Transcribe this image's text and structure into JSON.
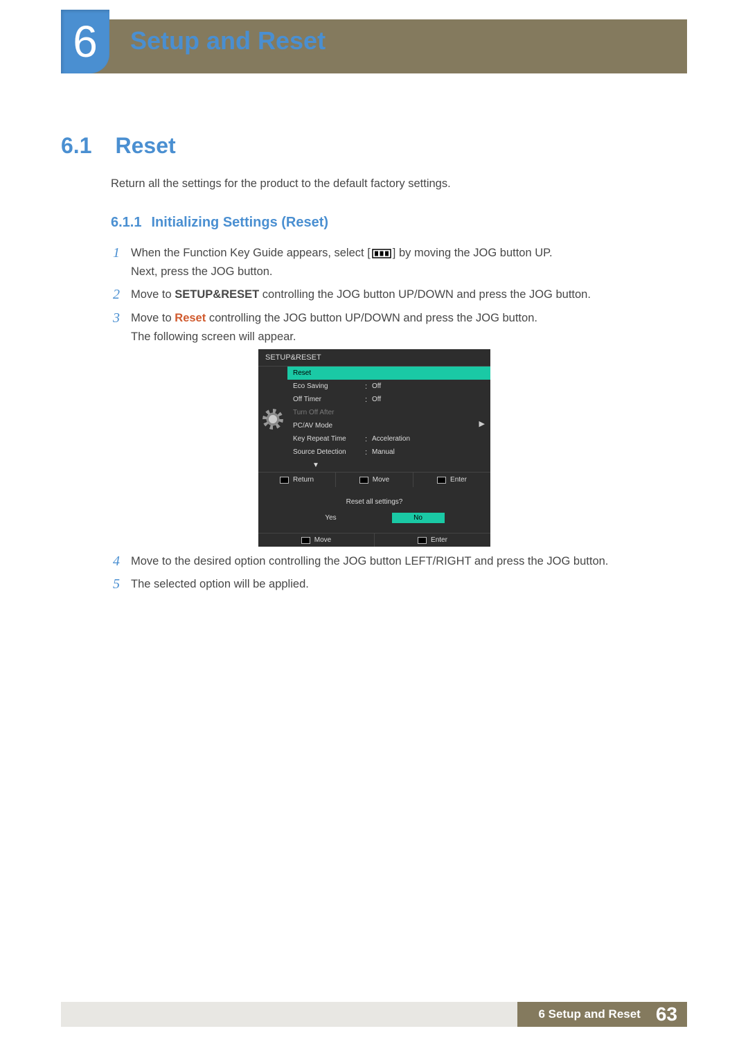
{
  "chapter": {
    "number": "6",
    "title": "Setup and Reset"
  },
  "section": {
    "number": "6.1",
    "title": "Reset"
  },
  "intro": "Return all the settings for the product to the default factory settings.",
  "subsection": {
    "number": "6.1.1",
    "title": "Initializing Settings (Reset)"
  },
  "steps": {
    "s1": {
      "n": "1",
      "before": "When the Function Key Guide appears, select ",
      "after": " by moving the JOG button UP.",
      "line2": "Next, press the JOG button."
    },
    "s2": {
      "n": "2",
      "before": "Move to ",
      "bold": "SETUP&RESET",
      "after": " controlling the JOG button UP/DOWN and press the JOG button."
    },
    "s3": {
      "n": "3",
      "before": "Move to ",
      "red": "Reset",
      "after": " controlling the JOG button UP/DOWN and press the JOG button.",
      "line2": "The following screen will appear."
    },
    "s4": {
      "n": "4",
      "text": "Move to the desired option controlling the JOG button LEFT/RIGHT and press the JOG button."
    },
    "s5": {
      "n": "5",
      "text": "The selected option will be applied."
    }
  },
  "osd": {
    "header": "SETUP&RESET",
    "rows": {
      "reset": {
        "label": "Reset"
      },
      "eco": {
        "label": "Eco Saving",
        "value": "Off"
      },
      "timer": {
        "label": "Off Timer",
        "value": "Off"
      },
      "turnoff": {
        "label": "Turn Off After"
      },
      "pcav": {
        "label": "PC/AV Mode"
      },
      "key": {
        "label": "Key Repeat Time",
        "value": "Acceleration"
      },
      "src": {
        "label": "Source Detection",
        "value": "Manual"
      }
    },
    "footer": {
      "return": "Return",
      "move": "Move",
      "enter": "Enter"
    }
  },
  "dialog": {
    "question": "Reset all settings?",
    "yes": "Yes",
    "no": "No",
    "footer": {
      "move": "Move",
      "enter": "Enter"
    }
  },
  "page_footer": {
    "label": "6 Setup and Reset",
    "page": "63"
  }
}
